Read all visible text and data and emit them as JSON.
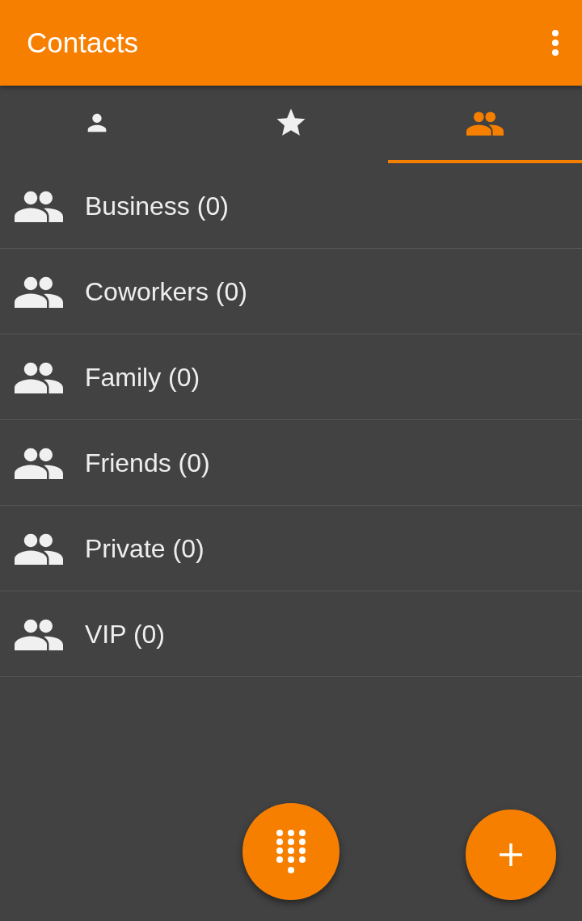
{
  "app_bar": {
    "title": "Contacts"
  },
  "tabs": [
    {
      "kind": "person",
      "selected": false
    },
    {
      "kind": "star",
      "selected": false
    },
    {
      "kind": "group",
      "selected": true
    }
  ],
  "groups": [
    {
      "label": "Business (0)"
    },
    {
      "label": "Coworkers (0)"
    },
    {
      "label": "Family (0)"
    },
    {
      "label": "Friends (0)"
    },
    {
      "label": "Private (0)"
    },
    {
      "label": "VIP (0)"
    }
  ]
}
